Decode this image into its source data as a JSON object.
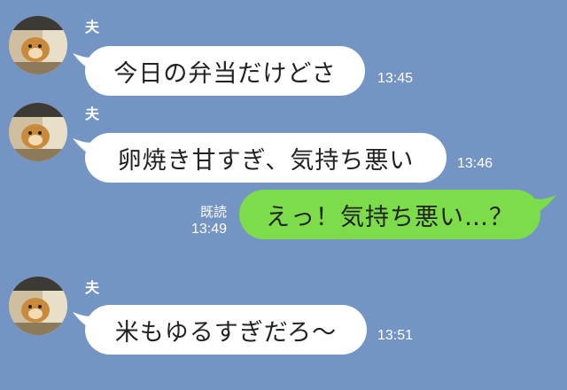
{
  "colors": {
    "background": "#7494c4",
    "incoming_bubble": "#ffffff",
    "outgoing_bubble": "#7ddc4a"
  },
  "messages": [
    {
      "sender": "夫",
      "text": "今日の弁当だけどさ",
      "time": "13:45",
      "avatar_icon": "dog-avatar-icon"
    },
    {
      "sender": "夫",
      "text": "卵焼き甘すぎ、気持ち悪い",
      "time": "13:46",
      "avatar_icon": "dog-avatar-icon"
    },
    {
      "text": "えっ！気持ち悪い…？",
      "read_label": "既読",
      "time": "13:49"
    },
    {
      "sender": "夫",
      "text": "米もゆるすぎだろ〜",
      "time": "13:51",
      "avatar_icon": "dog-avatar-icon"
    }
  ]
}
